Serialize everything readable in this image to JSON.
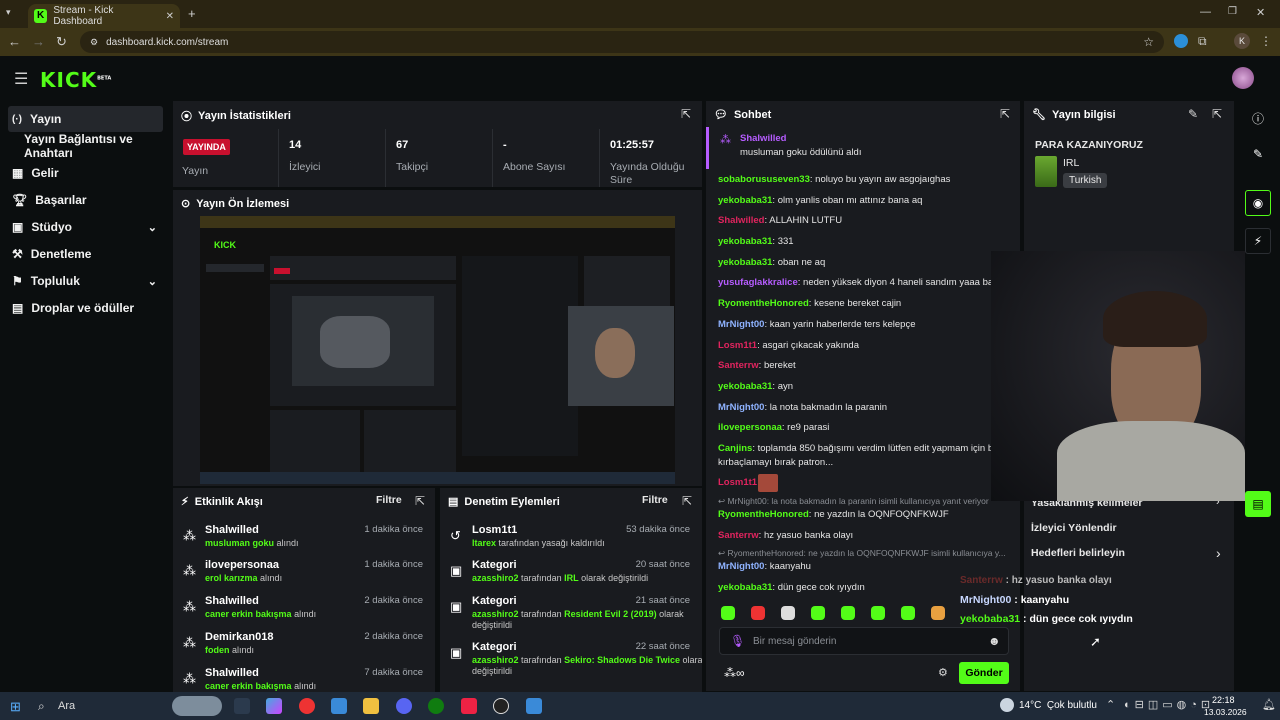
{
  "browser": {
    "tab_title": "Stream - Kick Dashboard",
    "url": "dashboard.kick.com/stream",
    "profile_initial": "K"
  },
  "header": {
    "logo": "KICK",
    "logo_sup": "BETA"
  },
  "sidebar": {
    "items": [
      {
        "label": "Yayın",
        "icon": "live-icon",
        "active": true
      },
      {
        "label": "Yayın Bağlantısı ve Anahtarı"
      },
      {
        "label": "Gelir",
        "icon": "revenue-icon"
      },
      {
        "label": "Başarılar",
        "icon": "trophy-icon"
      },
      {
        "label": "Stüdyo",
        "icon": "studio-icon",
        "expandable": true
      },
      {
        "label": "Denetleme",
        "icon": "moderation-icon"
      },
      {
        "label": "Topluluk",
        "icon": "community-icon",
        "expandable": true
      },
      {
        "label": "Droplar ve ödüller",
        "icon": "drops-icon"
      }
    ]
  },
  "stats": {
    "title": "Yayın İstatistikleri",
    "live_badge": "YAYINDA",
    "live_label": "Yayın",
    "items": [
      {
        "value": "14",
        "label": "İzleyici"
      },
      {
        "value": "67",
        "label": "Takipçi"
      },
      {
        "value": "-",
        "label": "Abone Sayısı"
      },
      {
        "value": "01:25:57",
        "label": "Yayında Olduğu Süre"
      }
    ]
  },
  "preview": {
    "title": "Yayın Ön İzlemesi"
  },
  "activity": {
    "title": "Etkinlik Akışı",
    "filter": "Filtre",
    "items": [
      {
        "name": "Shalwilled",
        "time": "1 dakika önce",
        "reward": "musluman goku",
        "suffix": "alındı"
      },
      {
        "name": "ilovepersonaa",
        "time": "1 dakika önce",
        "reward": "erol karızma",
        "suffix": "alındı"
      },
      {
        "name": "Shalwilled",
        "time": "2 dakika önce",
        "reward": "caner erkin bakışma",
        "suffix": "alındı"
      },
      {
        "name": "Demirkan018",
        "time": "2 dakika önce",
        "reward": "foden",
        "suffix": "alındı"
      },
      {
        "name": "Shalwilled",
        "time": "7 dakika önce",
        "reward": "caner erkin bakışma",
        "suffix": "alındı"
      }
    ]
  },
  "modlog": {
    "title": "Denetim Eylemleri",
    "filter": "Filtre",
    "items": [
      {
        "name": "Losm1t1",
        "time": "53 dakika önce",
        "who": "ltarex",
        "text": "tarafından yasağı kaldırıldı",
        "icon": "unban-icon"
      },
      {
        "name": "Kategori",
        "time": "20 saat önce",
        "who": "azasshiro2",
        "text": "tarafından",
        "cat": "IRL",
        "text2": "olarak değiştirildi",
        "icon": "category-icon"
      },
      {
        "name": "Kategori",
        "time": "21 saat önce",
        "who": "azasshiro2",
        "text": "tarafından",
        "cat": "Resident Evil 2 (2019)",
        "text2": "olarak",
        "text3": "değiştirildi",
        "icon": "category-icon"
      },
      {
        "name": "Kategori",
        "time": "22 saat önce",
        "who": "azasshiro2",
        "text": "tarafından",
        "cat": "Sekiro: Shadows Die Twice",
        "text2": "olarak",
        "text3": "değiştirildi",
        "icon": "category-icon"
      }
    ]
  },
  "chat": {
    "title": "Sohbet",
    "pinned_user": "Shalwilled",
    "pinned_text": "musluman goku ödülünü aldı",
    "messages": [
      {
        "user": "sobaborususeven33",
        "color": "#53fc18",
        "text": "noluyo bu yayın aw asgojaıghas"
      },
      {
        "user": "yekobaba31",
        "color": "#53fc18",
        "text": "olm yanlis oban mı attınız bana aq"
      },
      {
        "user": "Shalwilled",
        "color": "#e0245e",
        "text": "ALLAHIN LUTFU"
      },
      {
        "user": "yekobaba31",
        "color": "#53fc18",
        "text": "331"
      },
      {
        "user": "yekobaba31",
        "color": "#53fc18",
        "text": "oban ne aq"
      },
      {
        "user": "yusufaglakkralice",
        "color": "#b65cff",
        "text": "neden yüksek diyon 4 haneli sandım yaaa bak"
      },
      {
        "user": "RyomentheHonored",
        "color": "#53fc18",
        "text": "kesene bereket cajin"
      },
      {
        "user": "MrNight00",
        "color": "#8fb3ff",
        "text": "kaan yarin haberlerde ters kelepçe"
      },
      {
        "user": "Losm1t1",
        "color": "#e0245e",
        "text": "asgari çıkacak yakında"
      },
      {
        "user": "Santerrw",
        "color": "#e0245e",
        "text": "bereket"
      },
      {
        "user": "yekobaba31",
        "color": "#53fc18",
        "text": "ayn"
      },
      {
        "user": "MrNight00",
        "color": "#8fb3ff",
        "text": "la nota bakmadın la paranin"
      },
      {
        "user": "ilovepersonaa",
        "color": "#53fc18",
        "text": "re9 parasi"
      },
      {
        "user": "Canjins",
        "color": "#53fc18",
        "text": "toplamda 850 bağışımı verdim lütfen edit yapmam için ben"
      },
      {
        "user": "",
        "color": "#e6e6e6",
        "text": "kırbaçlamayı bırak patron..."
      },
      {
        "user": "Losm1t1",
        "color": "#e0245e",
        "text": ""
      }
    ],
    "reply1": "MrNight00: la nota bakmadın la paranin isimli kullanıcıya yanıt veriyor",
    "reply1_msg": {
      "user": "RyomentheHonored",
      "text": "ne yazdın la OQNFOQNFKWJF"
    },
    "msg_after1": {
      "user": "Santerrw",
      "text": "hz yasuo banka olayı"
    },
    "reply2": "RyomentheHonored: ne yazdın la OQNFOQNFKWJF isimli kullanıcıya y...",
    "reply2_msg": {
      "user": "MrNight00",
      "text": "kaanyahu"
    },
    "last": {
      "user": "yekobaba31",
      "text": "dün gece cok ıyıydın"
    },
    "input_placeholder": "Bir mesaj gönderin",
    "send": "Gönder"
  },
  "info": {
    "title": "Yayın bilgisi",
    "stream_title": "PARA KAZANIYORUZ",
    "category": "IRL",
    "tag": "Turkish",
    "menu": [
      {
        "label": "Yasaklanmış kelimeler"
      },
      {
        "label": "İzleyici Yönlendir"
      },
      {
        "label": "Hedefleri belirleyin"
      }
    ]
  },
  "overlay_chat": [
    {
      "user": "Santerrw",
      "text": "hz yasuo banka olayı"
    },
    {
      "user": "MrNight00",
      "text": "kaanyahu"
    },
    {
      "user": "yekobaba31",
      "text": "dün gece cok ıyıydın"
    }
  ],
  "taskbar": {
    "search": "Ara",
    "weather": "14°C  Çok bulutlu",
    "time": "22:18",
    "date": "13.03.2026"
  }
}
